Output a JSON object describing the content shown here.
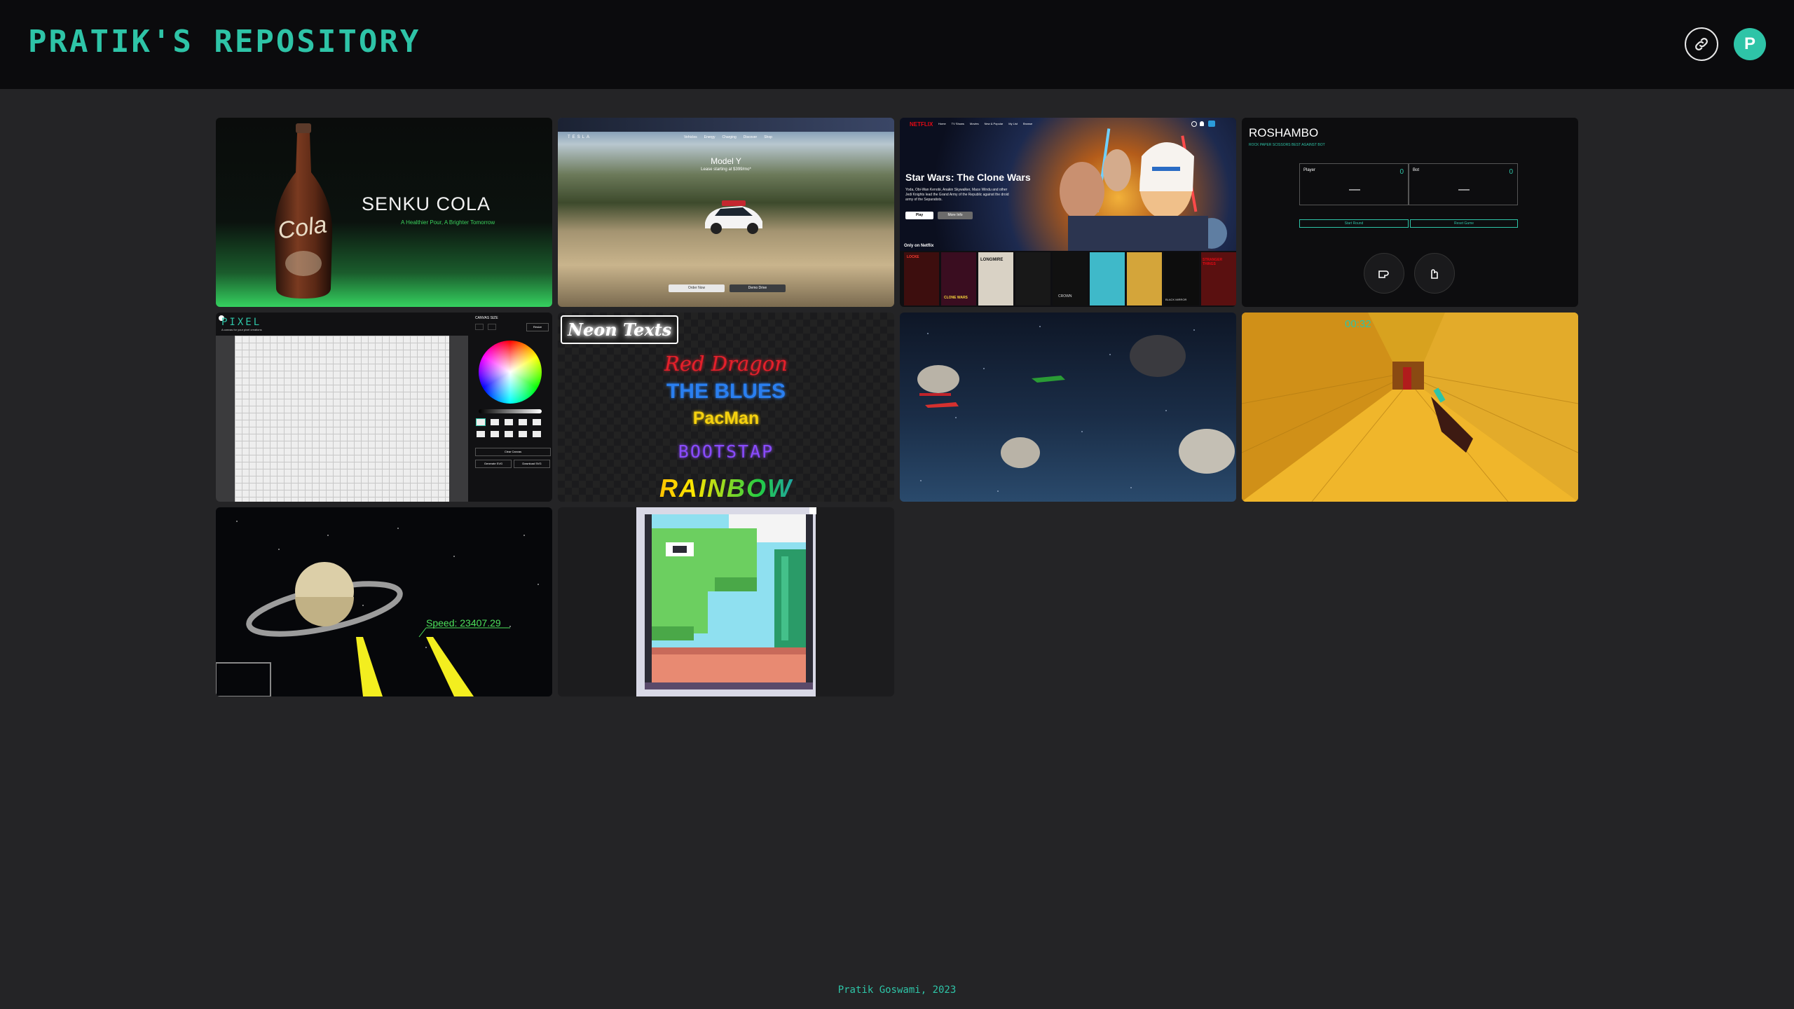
{
  "header": {
    "title": "PRATIK'S REPOSITORY",
    "link_icon": "link-icon",
    "avatar_letter": "P"
  },
  "cards": {
    "senku": {
      "title": "SENKU COLA",
      "tagline": "A Healthier Pour, A Brighter Tomorrow",
      "bottle_text": "Cola"
    },
    "tesla": {
      "brand": "TESLA",
      "nav": [
        "Vehicles",
        "Energy",
        "Charging",
        "Discover",
        "Shop"
      ],
      "model": "Model Y",
      "subtitle": "Lease starting at $399/mo*",
      "btn_order": "Order Now",
      "btn_demo": "Demo Drive"
    },
    "netflix": {
      "brand": "NETFLIX",
      "nav": [
        "Home",
        "TV Shows",
        "Movies",
        "New & Popular",
        "My List",
        "Browse"
      ],
      "show_title": "Star Wars: The Clone Wars",
      "description": "Yoda, Obi-Wan Kenobi, Anakin Skywalker, Mace Windu and other Jedi Knights lead the Grand Army of the Republic against the droid army of the Separatists.",
      "btn_play": "Play",
      "btn_info": "More Info",
      "row_title": "Only on Netflix",
      "poster_labels": [
        "LOCKE",
        "CLONE WARS",
        "LONGMIRE",
        "",
        "CROWN",
        "",
        "",
        "BLACK MIRROR",
        "STRANGER THINGS",
        ""
      ]
    },
    "roshambo": {
      "title": "ROSHAMBO",
      "subtitle": "ROCK PAPER SCISSORS BEST AGAINST BOT",
      "player_label": "Player",
      "player_score": "0",
      "bot_label": "Bot",
      "bot_score": "0",
      "player_move": "—",
      "bot_move": "—",
      "btn_start": "Start Round",
      "btn_reset": "Reset Game"
    },
    "pixel": {
      "title": "PIXEL",
      "subtitle": "A canvas for your pixel creations",
      "canvas_size": "CANVAS SIZE",
      "btn_resize": "Resize",
      "btn_clear": "Clear Canvas",
      "btn_generate": "Generate SVG",
      "btn_download": "Download SVG"
    },
    "neon": {
      "badge": "Neon Texts",
      "lines": [
        "Red Dragon",
        "THE BLUES",
        "PacMan",
        "BOOTSTAP",
        "RAINBOW"
      ]
    },
    "doom": {
      "timer": "00:32"
    },
    "space": {
      "speed": "Speed: 23407.29"
    }
  },
  "footer": {
    "text": "Pratik Goswami, 2023"
  }
}
